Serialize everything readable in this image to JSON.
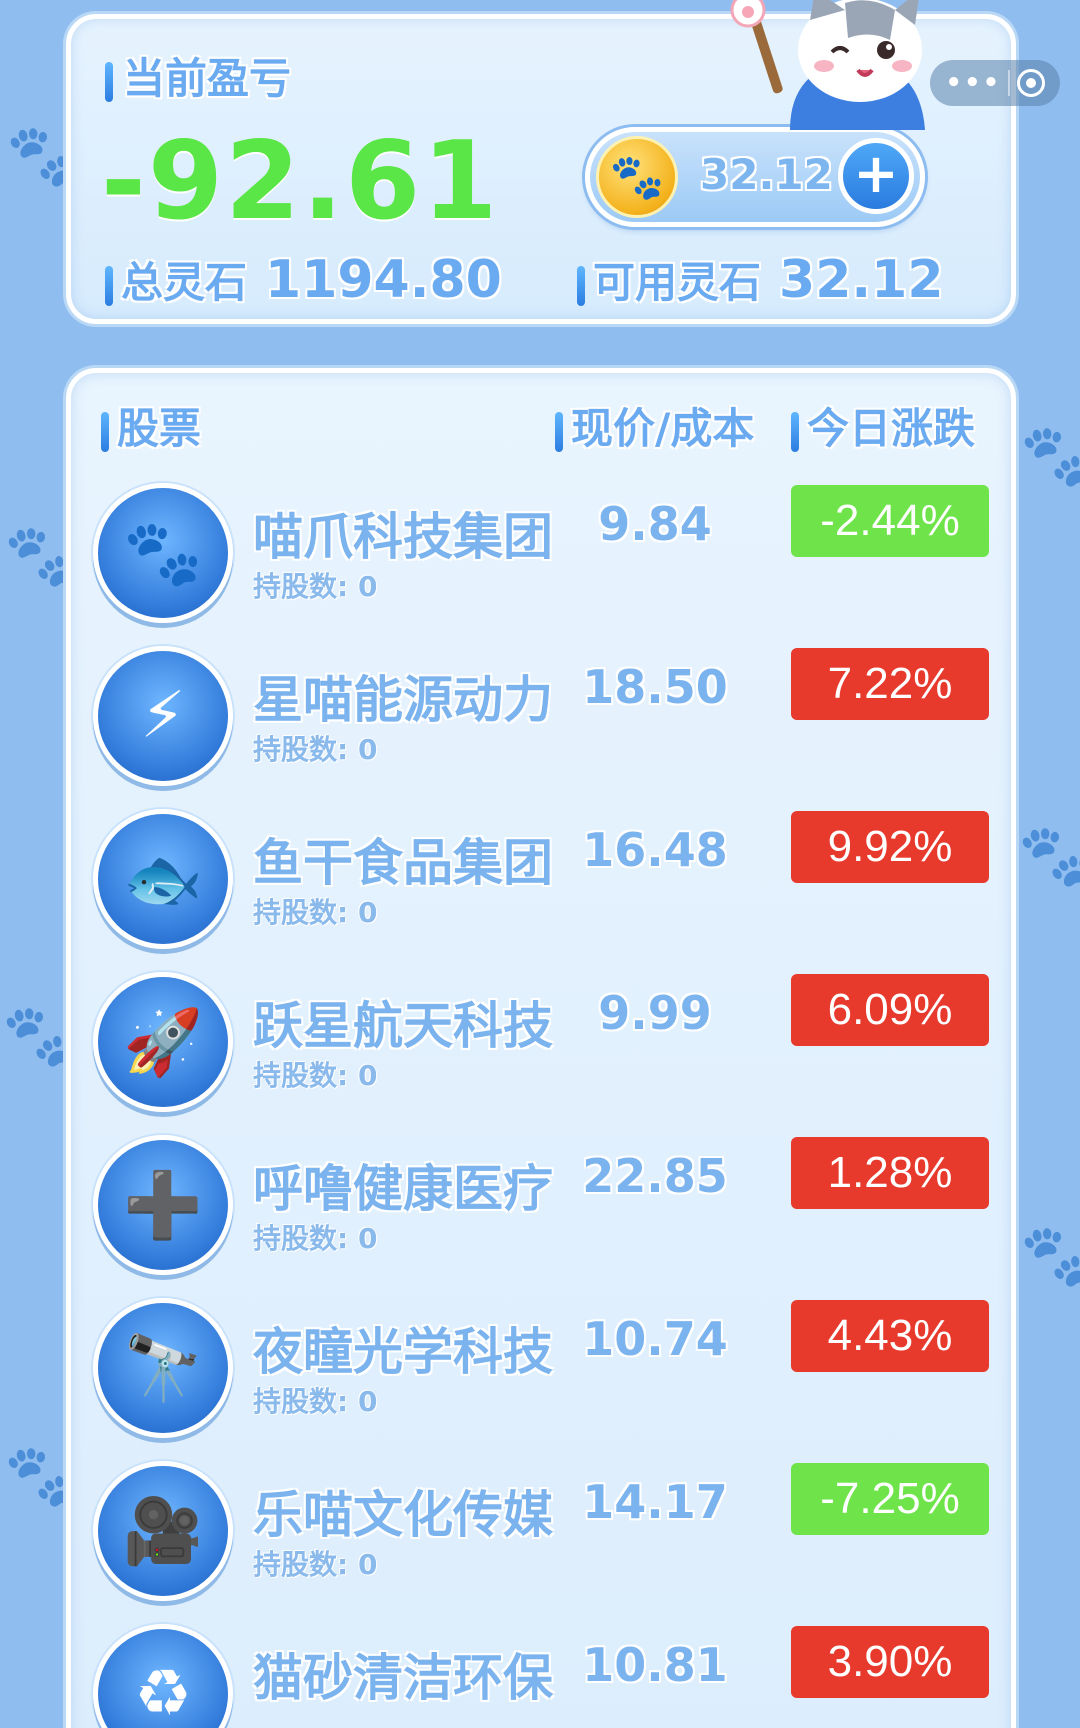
{
  "summary": {
    "pnl_label": "当前盈亏",
    "pnl_value": "-92.61",
    "total_label": "总灵石",
    "total_value": "1194.80",
    "available_label": "可用灵石",
    "available_value": "32.12",
    "coin_balance": "32.12",
    "plus_symbol": "+",
    "coin_icon": "paw-coin-icon"
  },
  "capsule": {
    "more_symbol": "•••"
  },
  "colors": {
    "loss_green": "#59e646",
    "badge_up": "#e8392d",
    "badge_down": "#6fe44a",
    "label_blue": "#7ab3ee"
  },
  "list": {
    "headers": {
      "stock": "股票",
      "price": "现价/成本",
      "change": "今日涨跌"
    },
    "holding_prefix": "持股数: ",
    "stocks": [
      {
        "name": "喵爪科技集团",
        "holdings": "持股数: 0",
        "price": "9.84",
        "change": "-2.44%",
        "direction": "down",
        "icon": "paw-circuit-icon"
      },
      {
        "name": "星喵能源动力",
        "holdings": "持股数: 0",
        "price": "18.50",
        "change": "7.22%",
        "direction": "up",
        "icon": "lightning-battery-icon"
      },
      {
        "name": "鱼干食品集团",
        "holdings": "持股数: 0",
        "price": "16.48",
        "change": "9.92%",
        "direction": "up",
        "icon": "fish-snack-icon"
      },
      {
        "name": "跃星航天科技",
        "holdings": "持股数: 0",
        "price": "9.99",
        "change": "6.09%",
        "direction": "up",
        "icon": "rocket-icon"
      },
      {
        "name": "呼噜健康医疗",
        "holdings": "持股数: 0",
        "price": "22.85",
        "change": "1.28%",
        "direction": "up",
        "icon": "doctor-cat-icon"
      },
      {
        "name": "夜瞳光学科技",
        "holdings": "持股数: 0",
        "price": "10.74",
        "change": "4.43%",
        "direction": "up",
        "icon": "telescope-icon"
      },
      {
        "name": "乐喵文化传媒",
        "holdings": "持股数: 0",
        "price": "14.17",
        "change": "-7.25%",
        "direction": "down",
        "icon": "camera-mic-icon"
      },
      {
        "name": "猫砂清洁环保",
        "holdings": "",
        "price": "10.81",
        "change": "3.90%",
        "direction": "up",
        "icon": "recycle-icon"
      }
    ]
  }
}
